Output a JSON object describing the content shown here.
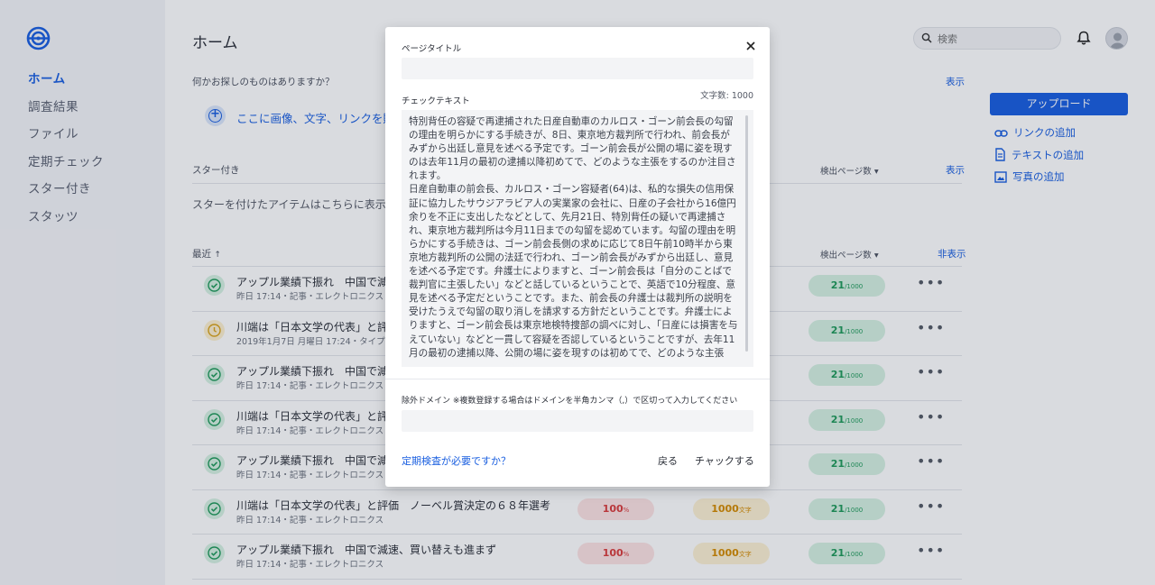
{
  "sidebar": {
    "items": [
      {
        "label": "ホーム",
        "active": true
      },
      {
        "label": "調査結果"
      },
      {
        "label": "ファイル"
      },
      {
        "label": "定期チェック"
      },
      {
        "label": "スター付き"
      },
      {
        "label": "スタッツ"
      }
    ]
  },
  "header": {
    "title": "ホーム",
    "search_placeholder": "検索"
  },
  "search_section": {
    "question": "何かお探しのものはありますか？",
    "show": "表示",
    "drop_text": "ここに画像、文字、リンクを貼り付"
  },
  "starred_section": {
    "title": "スター付き",
    "column": "検出ページ数 ▾",
    "show": "表示",
    "empty": "スターを付けたアイテムはこちらに表示され"
  },
  "recent_section": {
    "title": "最近",
    "sort_arrow": "↑",
    "column": "検出ページ数 ▾",
    "hide": "非表示"
  },
  "rows": [
    {
      "status": "ok",
      "title": "アップル業績下振れ　中国で減速、",
      "meta": "昨日 17:14・記事・エレクトロニクス",
      "green": "21",
      "green_unit": "/1000"
    },
    {
      "status": "warn",
      "title": "川端は「日本文学の代表」と評価",
      "meta": "2019年1月7日 月曜日 17:24・タイプ・フ",
      "green": "21",
      "green_unit": "/1000"
    },
    {
      "status": "ok",
      "title": "アップル業績下振れ　中国で減速、",
      "meta": "昨日 17:14・記事・エレクトロニクス",
      "green": "21",
      "green_unit": "/1000"
    },
    {
      "status": "ok",
      "title": "川端は「日本文学の代表」と評価",
      "meta": "昨日 17:14・記事・エレクトロニクス",
      "green": "21",
      "green_unit": "/1000"
    },
    {
      "status": "ok",
      "title": "アップル業績下振れ　中国で減速、",
      "meta": "昨日 17:14・記事・エレクトロニクス",
      "green": "21",
      "green_unit": "/1000"
    },
    {
      "status": "ok",
      "title": "川端は「日本文学の代表」と評価　ノーベル賞決定の６８年選考",
      "meta": "昨日 17:14・記事・エレクトロニクス",
      "red": "100",
      "red_unit": "%",
      "yellow": "1000",
      "yellow_unit": "文字",
      "green": "21",
      "green_unit": "/1000"
    },
    {
      "status": "ok",
      "title": "アップル業績下振れ　中国で減速、買い替えも進まず",
      "meta": "昨日 17:14・記事・エレクトロニクス",
      "red": "100",
      "red_unit": "%",
      "yellow": "1000",
      "yellow_unit": "文字",
      "green": "21",
      "green_unit": "/1000"
    }
  ],
  "right_panel": {
    "upload": "アップロード",
    "add_link": "リンクの追加",
    "add_text": "テキストの追加",
    "add_photo": "写真の追加"
  },
  "modal": {
    "page_title_label": "ページタイトル",
    "page_title_value": "",
    "check_text_label": "チェックテキスト",
    "char_count": "文字数: 1000",
    "check_text": "特別背任の容疑で再逮捕された日産自動車のカルロス・ゴーン前会長の勾留の理由を明らかにする手続きが、8日、東京地方裁判所で行われ、前会長がみずから出廷し意見を述べる予定です。ゴーン前会長が公開の場に姿を現すのは去年11月の最初の逮捕以降初めてで、どのような主張をするのか注目されます。\n日産自動車の前会長、カルロス・ゴーン容疑者(64)は、私的な損失の信用保証に協力したサウジアラビア人の実業家の会社に、日産の子会社から16億円余りを不正に支出したなどとして、先月21日、特別背任の疑いで再逮捕され、東京地方裁判所は今月11日までの勾留を認めています。勾留の理由を明らかにする手続きは、ゴーン前会長側の求めに応じて8日午前10時半から東京地方裁判所の公開の法廷で行われ、ゴーン前会長がみずから出廷し、意見を述べる予定です。弁護士によりますと、ゴーン前会長は「自分のことばで裁判官に主張したい」などと話しているということで、英語で10分程度、意見を述べる予定だということです。また、前会長の弁護士は裁判所の説明を受けたうえで勾留の取り消しを請求する方針だということです。弁護士によりますと、ゴーン前会長は東京地検特捜部の調べに対し、「日産には損害を与えていない」などと一貫して容疑を否認しているということですが、去年11月の最初の逮捕以降、公開の場に姿を現すのは初めてで、どのような主張",
    "exclude_label": "除外ドメイン ※複数登録する場合はドメインを半角カンマ（,）で区切って入力してください",
    "exclude_value": "",
    "periodic_link": "定期検査が必要ですか？",
    "back": "戻る",
    "check": "チャックする"
  }
}
